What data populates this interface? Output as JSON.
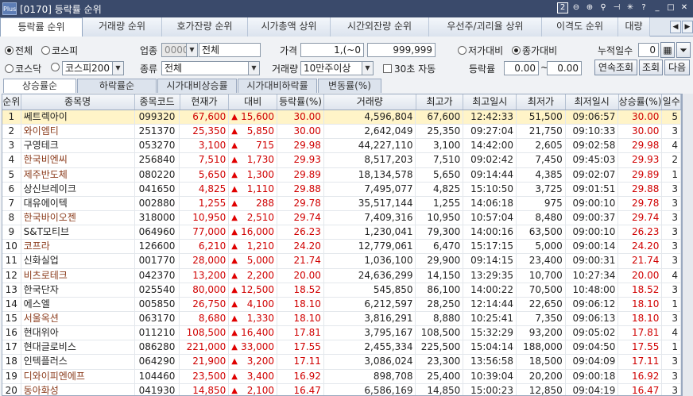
{
  "window": {
    "logo": "Plus",
    "title": "[0170] 등락률 순위",
    "page_num": "2",
    "icons": [
      "zoom-out-icon",
      "zoom-in-icon",
      "magnifier-icon",
      "pin-icon",
      "settings-icon",
      "help-icon",
      "minimize-icon",
      "maximize-icon",
      "close-icon"
    ]
  },
  "main_tabs": [
    "등락률 순위",
    "거래량 순위",
    "호가잔량 순위",
    "시가총액 상위",
    "시간외잔량 순위",
    "우선주/괴리율 상위",
    "이격도 순위",
    "대량"
  ],
  "filters": {
    "market_all": "전체",
    "market_kospi": "코스피",
    "market_kosdaq": "코스닥",
    "market_kospi_sel": "코스피200",
    "industry_label": "업종",
    "industry_code": "0000",
    "industry_name": "전체",
    "type_label": "종류",
    "type_value": "전체",
    "price_label": "가격",
    "price_from": "1,(~0",
    "price_to": "999,999",
    "volume_label": "거래량",
    "volume_value": "10만주이상",
    "auto_30": "30초 자동",
    "vs_low": "저가대비",
    "vs_close": "종가대비",
    "cum_days_label": "누적일수",
    "cum_days": "0",
    "rate_label": "등락률",
    "rate_from": "0.00",
    "rate_to": "0.00",
    "tilde": "~",
    "btn_continuous": "연속조회",
    "btn_query": "조회",
    "btn_next": "다음"
  },
  "sub_tabs": [
    "상승률순",
    "하락률순",
    "시가대비상승률",
    "시가대비하락률",
    "변동률(%)"
  ],
  "columns": [
    "순위",
    "종목명",
    "종목코드",
    "현재가",
    "대비",
    "등락률(%)",
    "거래량",
    "최고가",
    "최고일시",
    "최저가",
    "최저일시",
    "상승률(%)",
    "일수"
  ],
  "rows": [
    {
      "rank": "1",
      "name": "쎄트렉아이",
      "code": "099320",
      "price": "67,600",
      "diff": "15,600",
      "rate": "30.00",
      "volume": "4,596,804",
      "high": "67,600",
      "high_time": "12:42:33",
      "low": "51,500",
      "low_time": "09:06:57",
      "up_rate": "30.00",
      "days": "5"
    },
    {
      "rank": "2",
      "name": "와이엠티",
      "code": "251370",
      "price": "25,350",
      "diff": "5,850",
      "rate": "30.00",
      "volume": "2,642,049",
      "high": "25,350",
      "high_time": "09:27:04",
      "low": "21,750",
      "low_time": "09:10:33",
      "up_rate": "30.00",
      "days": "3"
    },
    {
      "rank": "3",
      "name": "구영테크",
      "code": "053270",
      "price": "3,100",
      "diff": "715",
      "rate": "29.98",
      "volume": "44,227,110",
      "high": "3,100",
      "high_time": "14:42:00",
      "low": "2,605",
      "low_time": "09:02:58",
      "up_rate": "29.98",
      "days": "4"
    },
    {
      "rank": "4",
      "name": "한국비엔씨",
      "code": "256840",
      "price": "7,510",
      "diff": "1,730",
      "rate": "29.93",
      "volume": "8,517,203",
      "high": "7,510",
      "high_time": "09:02:42",
      "low": "7,450",
      "low_time": "09:45:03",
      "up_rate": "29.93",
      "days": "2"
    },
    {
      "rank": "5",
      "name": "제주반도체",
      "code": "080220",
      "price": "5,650",
      "diff": "1,300",
      "rate": "29.89",
      "volume": "18,134,578",
      "high": "5,650",
      "high_time": "09:14:44",
      "low": "4,385",
      "low_time": "09:02:07",
      "up_rate": "29.89",
      "days": "1"
    },
    {
      "rank": "6",
      "name": "상신브레이크",
      "code": "041650",
      "price": "4,825",
      "diff": "1,110",
      "rate": "29.88",
      "volume": "7,495,077",
      "high": "4,825",
      "high_time": "15:10:50",
      "low": "3,725",
      "low_time": "09:01:51",
      "up_rate": "29.88",
      "days": "3"
    },
    {
      "rank": "7",
      "name": "대유에이텍",
      "code": "002880",
      "price": "1,255",
      "diff": "288",
      "rate": "29.78",
      "volume": "35,517,144",
      "high": "1,255",
      "high_time": "14:06:18",
      "low": "975",
      "low_time": "09:00:10",
      "up_rate": "29.78",
      "days": "3"
    },
    {
      "rank": "8",
      "name": "한국바이오젠",
      "code": "318000",
      "price": "10,950",
      "diff": "2,510",
      "rate": "29.74",
      "volume": "7,409,316",
      "high": "10,950",
      "high_time": "10:57:04",
      "low": "8,480",
      "low_time": "09:00:37",
      "up_rate": "29.74",
      "days": "3"
    },
    {
      "rank": "9",
      "name": "S&T모티브",
      "code": "064960",
      "price": "77,000",
      "diff": "16,000",
      "rate": "26.23",
      "volume": "1,230,041",
      "high": "79,300",
      "high_time": "14:00:16",
      "low": "63,500",
      "low_time": "09:00:10",
      "up_rate": "26.23",
      "days": "3"
    },
    {
      "rank": "10",
      "name": "코프라",
      "code": "126600",
      "price": "6,210",
      "diff": "1,210",
      "rate": "24.20",
      "volume": "12,779,061",
      "high": "6,470",
      "high_time": "15:17:15",
      "low": "5,000",
      "low_time": "09:00:14",
      "up_rate": "24.20",
      "days": "3"
    },
    {
      "rank": "11",
      "name": "신화실업",
      "code": "001770",
      "price": "28,000",
      "diff": "5,000",
      "rate": "21.74",
      "volume": "1,036,100",
      "high": "29,900",
      "high_time": "09:14:15",
      "low": "23,400",
      "low_time": "09:00:31",
      "up_rate": "21.74",
      "days": "3"
    },
    {
      "rank": "12",
      "name": "비츠로테크",
      "code": "042370",
      "price": "13,200",
      "diff": "2,200",
      "rate": "20.00",
      "volume": "24,636,299",
      "high": "14,150",
      "high_time": "13:29:35",
      "low": "10,700",
      "low_time": "10:27:34",
      "up_rate": "20.00",
      "days": "4"
    },
    {
      "rank": "13",
      "name": "한국단자",
      "code": "025540",
      "price": "80,000",
      "diff": "12,500",
      "rate": "18.52",
      "volume": "545,850",
      "high": "86,100",
      "high_time": "14:00:22",
      "low": "70,500",
      "low_time": "10:48:00",
      "up_rate": "18.52",
      "days": "3"
    },
    {
      "rank": "14",
      "name": "에스엘",
      "code": "005850",
      "price": "26,750",
      "diff": "4,100",
      "rate": "18.10",
      "volume": "6,212,597",
      "high": "28,250",
      "high_time": "12:14:44",
      "low": "22,650",
      "low_time": "09:06:12",
      "up_rate": "18.10",
      "days": "1"
    },
    {
      "rank": "15",
      "name": "서울옥션",
      "code": "063170",
      "price": "8,680",
      "diff": "1,330",
      "rate": "18.10",
      "volume": "3,816,291",
      "high": "8,880",
      "high_time": "10:25:41",
      "low": "7,350",
      "low_time": "09:06:13",
      "up_rate": "18.10",
      "days": "3"
    },
    {
      "rank": "16",
      "name": "현대위아",
      "code": "011210",
      "price": "108,500",
      "diff": "16,400",
      "rate": "17.81",
      "volume": "3,795,167",
      "high": "108,500",
      "high_time": "15:32:29",
      "low": "93,200",
      "low_time": "09:05:02",
      "up_rate": "17.81",
      "days": "4"
    },
    {
      "rank": "17",
      "name": "현대글로비스",
      "code": "086280",
      "price": "221,000",
      "diff": "33,000",
      "rate": "17.55",
      "volume": "2,455,334",
      "high": "225,500",
      "high_time": "15:04:14",
      "low": "188,000",
      "low_time": "09:04:50",
      "up_rate": "17.55",
      "days": "1"
    },
    {
      "rank": "18",
      "name": "인텍플러스",
      "code": "064290",
      "price": "21,900",
      "diff": "3,200",
      "rate": "17.11",
      "volume": "3,086,024",
      "high": "23,300",
      "high_time": "13:56:58",
      "low": "18,500",
      "low_time": "09:04:09",
      "up_rate": "17.11",
      "days": "3"
    },
    {
      "rank": "19",
      "name": "디와이피엔에프",
      "code": "104460",
      "price": "23,500",
      "diff": "3,400",
      "rate": "16.92",
      "volume": "898,708",
      "high": "25,400",
      "high_time": "10:39:04",
      "low": "20,200",
      "low_time": "09:00:18",
      "up_rate": "16.92",
      "days": "3"
    },
    {
      "rank": "20",
      "name": "동아화성",
      "code": "041930",
      "price": "14,850",
      "diff": "2,100",
      "rate": "16.47",
      "volume": "6,586,169",
      "high": "14,850",
      "high_time": "15:00:23",
      "low": "12,850",
      "low_time": "09:04:19",
      "up_rate": "16.47",
      "days": "3"
    }
  ],
  "brown_rows": [
    1,
    3,
    4,
    7,
    9,
    11,
    14,
    18,
    19
  ],
  "colors": {
    "up": "#d00000",
    "name_highlight": "#8a3a1a",
    "selected_row": "#fff4c8",
    "titlebar": "#3a4a6b"
  }
}
